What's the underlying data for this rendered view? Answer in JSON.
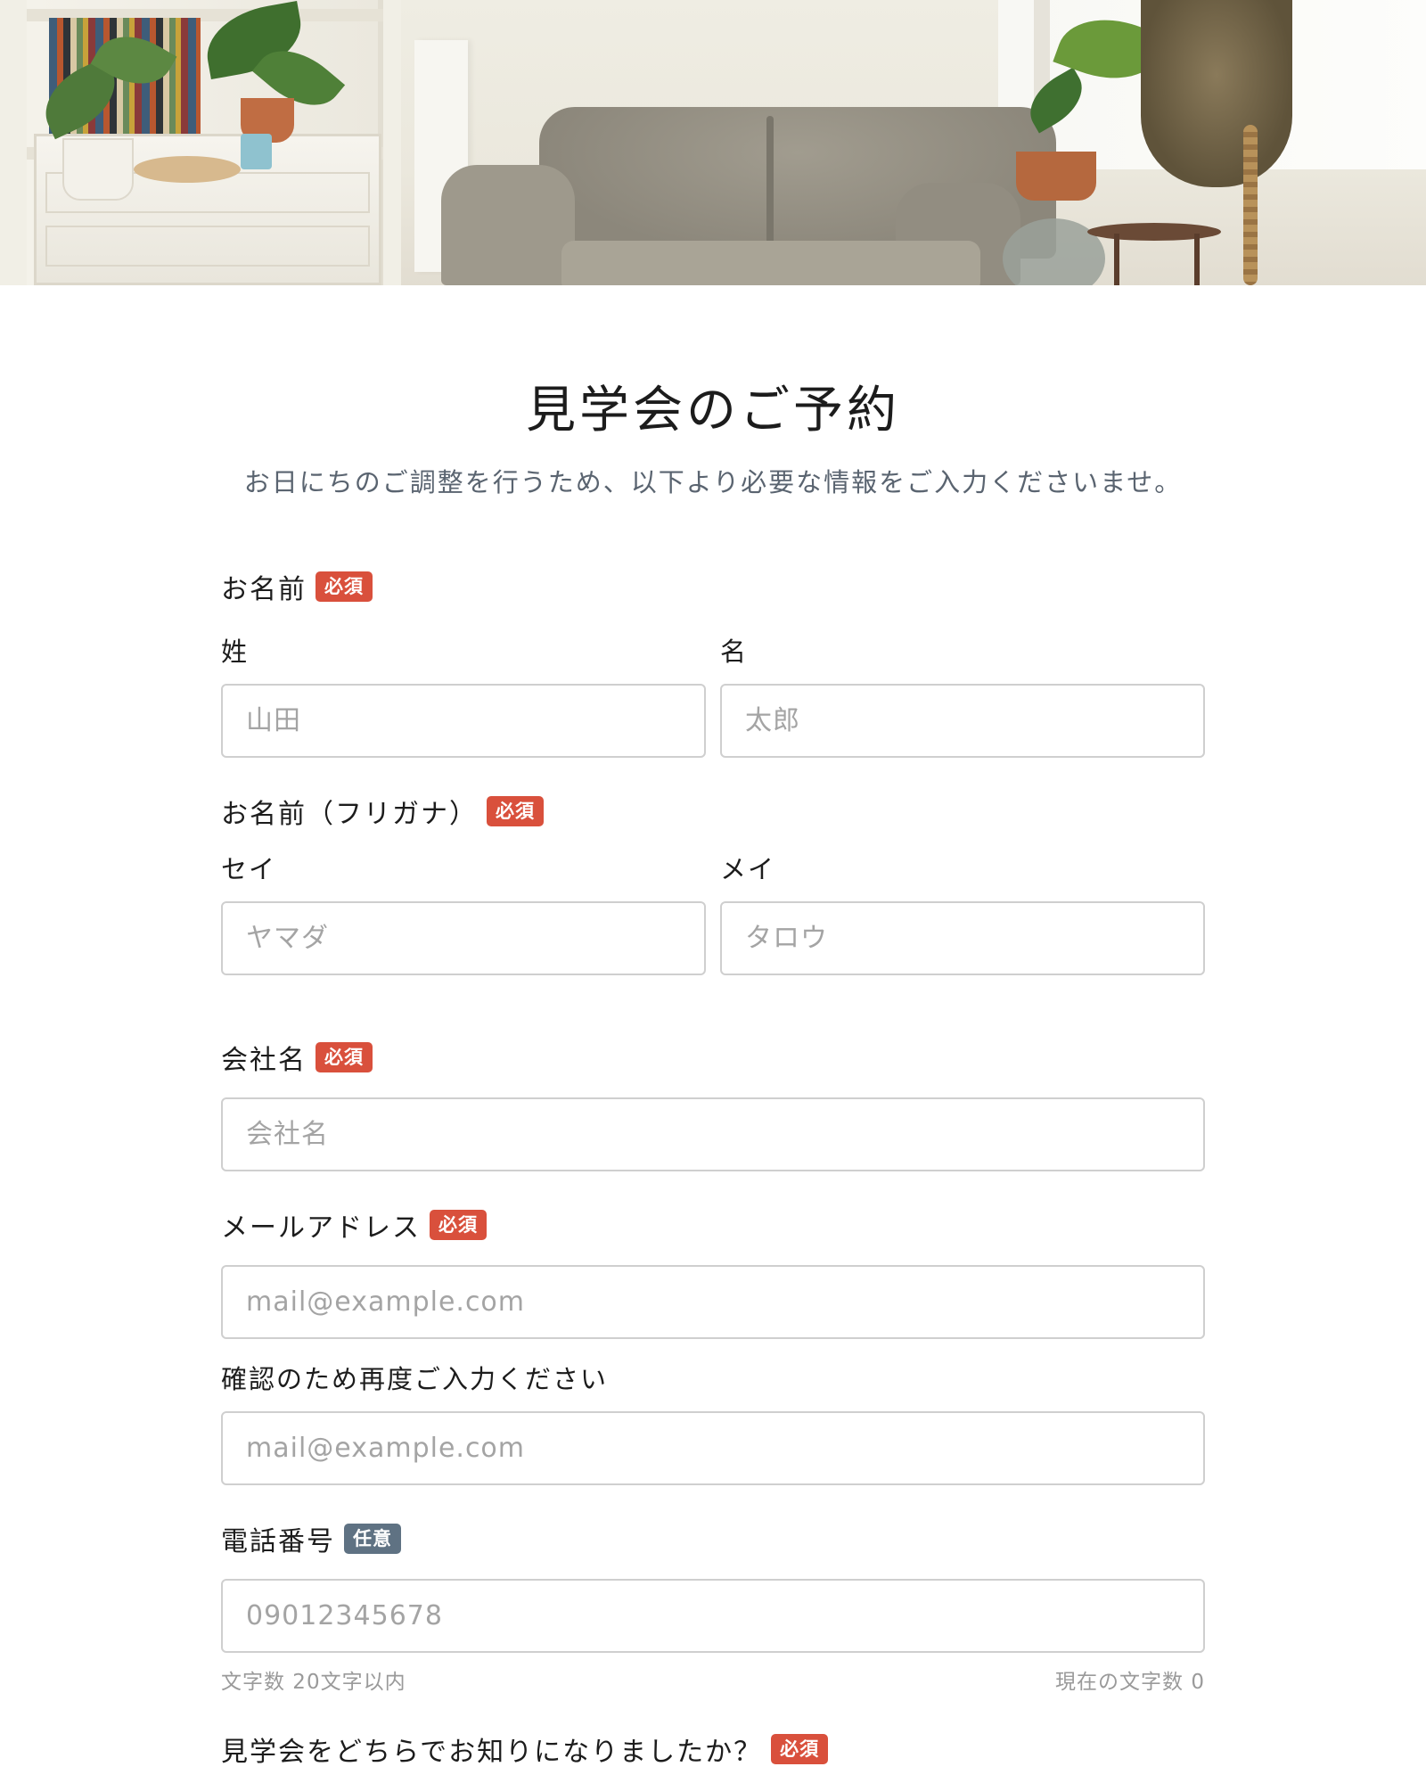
{
  "page": {
    "title": "見学会のご予約",
    "subtitle": "お日にちのご調整を行うため、以下より必要な情報をご入力くださいませ。"
  },
  "badges": {
    "required": "必須",
    "optional": "任意"
  },
  "name": {
    "label": "お名前",
    "last_label": "姓",
    "last_placeholder": "山田",
    "first_label": "名",
    "first_placeholder": "太郎"
  },
  "kana": {
    "label": "お名前（フリガナ）",
    "last_label": "セイ",
    "last_placeholder": "ヤマダ",
    "first_label": "メイ",
    "first_placeholder": "タロウ"
  },
  "company": {
    "label": "会社名",
    "placeholder": "会社名"
  },
  "email": {
    "label": "メールアドレス",
    "placeholder": "mail@example.com",
    "confirm_label": "確認のため再度ご入力ください",
    "confirm_placeholder": "mail@example.com"
  },
  "phone": {
    "label": "電話番号",
    "placeholder": "09012345678",
    "limit_hint": "文字数 20文字以内",
    "count_hint": "現在の文字数 0"
  },
  "source": {
    "label": "見学会をどちらでお知りになりましたか？"
  },
  "colors": {
    "required_badge": "#d9503c",
    "optional_badge": "#5f7283",
    "input_border": "#cfcfcf"
  }
}
